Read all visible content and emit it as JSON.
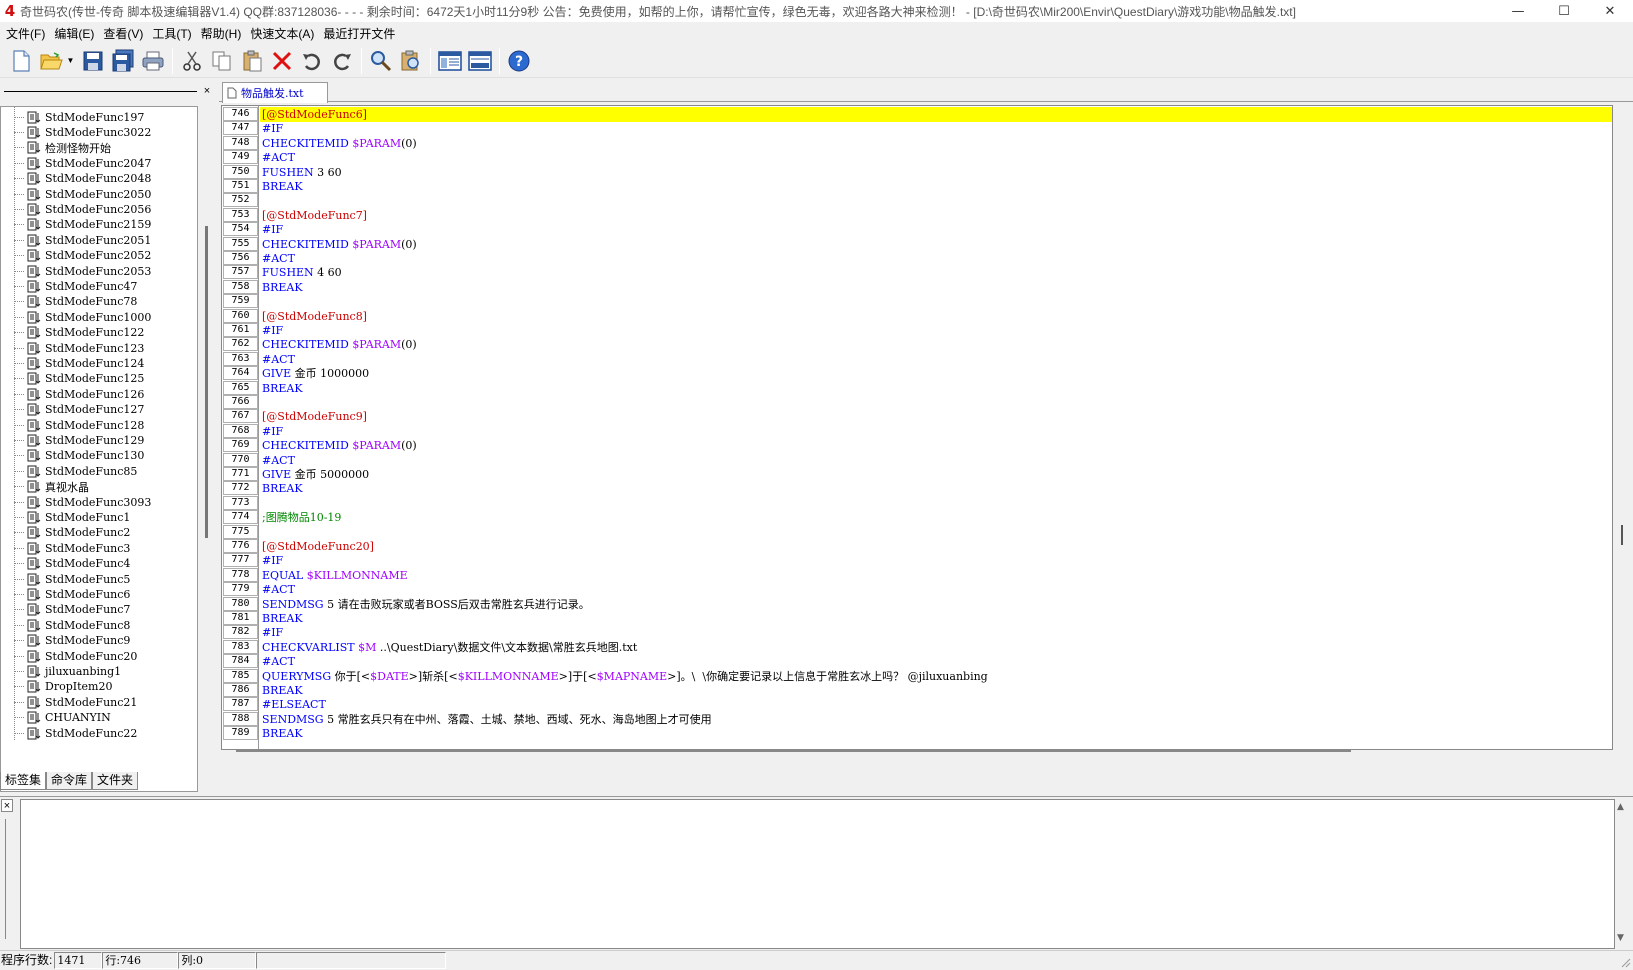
{
  "window": {
    "title": "奇世码农(传世-传奇 脚本极速编辑器V1.4) QQ群:837128036- - - - 剩余时间：6472天1小时11分9秒          公告：免费使用，如帮的上你，请帮忙宣传，绿色无毒，欢迎各路大神来检测！ - [D:\\奇世码农\\Mir200\\Envir\\QuestDiary\\游戏功能\\物品触发.txt]",
    "minimize": "—",
    "maximize": "☐",
    "close": "✕",
    "app_icon": "4"
  },
  "menu": [
    {
      "id": "file",
      "label": "文件(F)"
    },
    {
      "id": "edit",
      "label": "编辑(E)"
    },
    {
      "id": "view",
      "label": "查看(V)"
    },
    {
      "id": "tools",
      "label": "工具(T)"
    },
    {
      "id": "help",
      "label": "帮助(H)"
    },
    {
      "id": "quicktext",
      "label": "快速文本(A)"
    },
    {
      "id": "recent",
      "label": "最近打开文件"
    }
  ],
  "toolbar_icons": [
    "new-file-icon",
    "open-folder-icon",
    "save-icon",
    "save-all-icon",
    "print-icon",
    "cut-icon",
    "copy-icon",
    "paste-icon",
    "delete-icon",
    "undo-icon",
    "redo-icon",
    "find-icon",
    "replace-icon",
    "layout-panel-icon",
    "layout-rows-icon",
    "help-icon"
  ],
  "sidebar": {
    "close": "×",
    "items": [
      "StdModeFunc197",
      "StdModeFunc3022",
      "检测怪物开始",
      "StdModeFunc2047",
      "StdModeFunc2048",
      "StdModeFunc2050",
      "StdModeFunc2056",
      "StdModeFunc2159",
      "StdModeFunc2051",
      "StdModeFunc2052",
      "StdModeFunc2053",
      "StdModeFunc47",
      "StdModeFunc78",
      "StdModeFunc1000",
      "StdModeFunc122",
      "StdModeFunc123",
      "StdModeFunc124",
      "StdModeFunc125",
      "StdModeFunc126",
      "StdModeFunc127",
      "StdModeFunc128",
      "StdModeFunc129",
      "StdModeFunc130",
      "StdModeFunc85",
      "真视水晶",
      "StdModeFunc3093",
      "StdModeFunc1",
      "StdModeFunc2",
      "StdModeFunc3",
      "StdModeFunc4",
      "StdModeFunc5",
      "StdModeFunc6",
      "StdModeFunc7",
      "StdModeFunc8",
      "StdModeFunc9",
      "StdModeFunc20",
      "jiluxuanbing1",
      "DropItem20",
      "StdModeFunc21",
      "CHUANYIN",
      "StdModeFunc22"
    ],
    "tabs": [
      "标签集",
      "命令库",
      "文件夹"
    ]
  },
  "editor": {
    "tab_label": "物品触发.txt",
    "highlight_line": 746,
    "lines": [
      {
        "n": "746",
        "segs": [
          [
            "red",
            "[@StdModeFunc6]"
          ]
        ]
      },
      {
        "n": "747",
        "segs": [
          [
            "blue",
            "#IF"
          ]
        ]
      },
      {
        "n": "748",
        "segs": [
          [
            "blue",
            "CHECKITEMID "
          ],
          [
            "purple",
            "$PARAM"
          ],
          [
            "black",
            "(0)"
          ]
        ]
      },
      {
        "n": "749",
        "segs": [
          [
            "blue",
            "#ACT"
          ]
        ]
      },
      {
        "n": "750",
        "segs": [
          [
            "blue",
            "FUSHEN"
          ],
          [
            "black",
            " 3 60"
          ]
        ]
      },
      {
        "n": "751",
        "segs": [
          [
            "blue",
            "BREAK"
          ]
        ]
      },
      {
        "n": "752",
        "segs": []
      },
      {
        "n": "753",
        "segs": [
          [
            "red",
            "[@StdModeFunc7]"
          ]
        ]
      },
      {
        "n": "754",
        "segs": [
          [
            "blue",
            "#IF"
          ]
        ]
      },
      {
        "n": "755",
        "segs": [
          [
            "blue",
            "CHECKITEMID "
          ],
          [
            "purple",
            "$PARAM"
          ],
          [
            "black",
            "(0)"
          ]
        ]
      },
      {
        "n": "756",
        "segs": [
          [
            "blue",
            "#ACT"
          ]
        ]
      },
      {
        "n": "757",
        "segs": [
          [
            "blue",
            "FUSHEN"
          ],
          [
            "black",
            " 4 60"
          ]
        ]
      },
      {
        "n": "758",
        "segs": [
          [
            "blue",
            "BREAK"
          ]
        ]
      },
      {
        "n": "759",
        "segs": []
      },
      {
        "n": "760",
        "segs": [
          [
            "red",
            "[@StdModeFunc8]"
          ]
        ]
      },
      {
        "n": "761",
        "segs": [
          [
            "blue",
            "#IF"
          ]
        ]
      },
      {
        "n": "762",
        "segs": [
          [
            "blue",
            "CHECKITEMID "
          ],
          [
            "purple",
            "$PARAM"
          ],
          [
            "black",
            "(0)"
          ]
        ]
      },
      {
        "n": "763",
        "segs": [
          [
            "blue",
            "#ACT"
          ]
        ]
      },
      {
        "n": "764",
        "segs": [
          [
            "blue",
            "GIVE"
          ],
          [
            "black",
            " 金币 1000000"
          ]
        ]
      },
      {
        "n": "765",
        "segs": [
          [
            "blue",
            "BREAK"
          ]
        ]
      },
      {
        "n": "766",
        "segs": []
      },
      {
        "n": "767",
        "segs": [
          [
            "red",
            "[@StdModeFunc9]"
          ]
        ]
      },
      {
        "n": "768",
        "segs": [
          [
            "blue",
            "#IF"
          ]
        ]
      },
      {
        "n": "769",
        "segs": [
          [
            "blue",
            "CHECKITEMID "
          ],
          [
            "purple",
            "$PARAM"
          ],
          [
            "black",
            "(0)"
          ]
        ]
      },
      {
        "n": "770",
        "segs": [
          [
            "blue",
            "#ACT"
          ]
        ]
      },
      {
        "n": "771",
        "segs": [
          [
            "blue",
            "GIVE"
          ],
          [
            "black",
            " 金币 5000000"
          ]
        ]
      },
      {
        "n": "772",
        "segs": [
          [
            "blue",
            "BREAK"
          ]
        ]
      },
      {
        "n": "773",
        "segs": []
      },
      {
        "n": "774",
        "segs": [
          [
            "green",
            ";图腾物品10-19"
          ]
        ]
      },
      {
        "n": "775",
        "segs": []
      },
      {
        "n": "776",
        "segs": [
          [
            "red",
            "[@StdModeFunc20]"
          ]
        ]
      },
      {
        "n": "777",
        "segs": [
          [
            "blue",
            "#IF"
          ]
        ]
      },
      {
        "n": "778",
        "segs": [
          [
            "blue",
            "EQUAL "
          ],
          [
            "purple",
            "$KILLMONNAME"
          ]
        ]
      },
      {
        "n": "779",
        "segs": [
          [
            "blue",
            "#ACT"
          ]
        ]
      },
      {
        "n": "780",
        "segs": [
          [
            "blue",
            "SENDMSG"
          ],
          [
            "black",
            " 5 请在击败玩家或者BOSS后双击常胜玄兵进行记录。"
          ]
        ]
      },
      {
        "n": "781",
        "segs": [
          [
            "blue",
            "BREAK"
          ]
        ]
      },
      {
        "n": "782",
        "segs": [
          [
            "blue",
            "#IF"
          ]
        ]
      },
      {
        "n": "783",
        "segs": [
          [
            "blue",
            "CHECKVARLIST "
          ],
          [
            "purple",
            "$M"
          ],
          [
            "black",
            " ..\\QuestDiary\\数据文件\\文本数据\\常胜玄兵地图.txt"
          ]
        ]
      },
      {
        "n": "784",
        "segs": [
          [
            "blue",
            "#ACT"
          ]
        ]
      },
      {
        "n": "785",
        "segs": [
          [
            "blue",
            "QUERYMSG"
          ],
          [
            "black",
            " 你于[<"
          ],
          [
            "purple",
            "$DATE"
          ],
          [
            "black",
            ">]斩杀[<"
          ],
          [
            "purple",
            "$KILLMONNAME"
          ],
          [
            "black",
            ">]于[<"
          ],
          [
            "purple",
            "$MAPNAME"
          ],
          [
            "black",
            ">]。\\  \\你确定要记录以上信息于常胜玄冰上吗？ @jiluxuanbing"
          ]
        ]
      },
      {
        "n": "786",
        "segs": [
          [
            "blue",
            "BREAK"
          ]
        ]
      },
      {
        "n": "787",
        "segs": [
          [
            "blue",
            "#ELSEACT"
          ]
        ]
      },
      {
        "n": "788",
        "segs": [
          [
            "blue",
            "SENDMSG"
          ],
          [
            "black",
            " 5 常胜玄兵只有在中州、落霞、土城、禁地、西域、死水、海岛地图上才可使用"
          ]
        ]
      },
      {
        "n": "789",
        "segs": [
          [
            "blue",
            "BREAK"
          ]
        ]
      }
    ]
  },
  "output": {
    "close": "×",
    "scroll_up": "▲",
    "scroll_down": "▼"
  },
  "status": {
    "lines_label": "程序行数:",
    "lines_value": "1471",
    "row_label": "行:746",
    "col_label": "列:0"
  },
  "colors": {
    "keyword": "#0000ff",
    "variable": "#a000ff",
    "label": "#cc0000",
    "comment": "#008800",
    "highlight": "#ffff00"
  }
}
